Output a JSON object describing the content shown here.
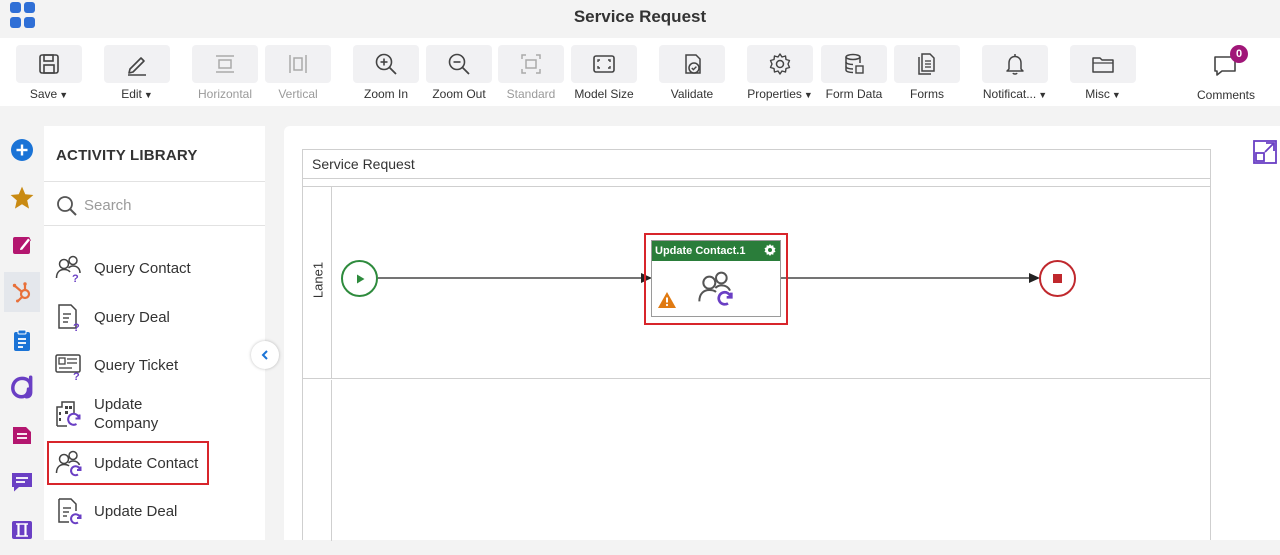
{
  "app": {
    "title": "Service Request"
  },
  "toolbar": {
    "save": "Save",
    "edit": "Edit",
    "horizontal": "Horizontal",
    "vertical": "Vertical",
    "zoom_in": "Zoom In",
    "zoom_out": "Zoom Out",
    "standard": "Standard",
    "model_size": "Model Size",
    "validate": "Validate",
    "properties": "Properties",
    "form_data": "Form Data",
    "forms": "Forms",
    "notifications": "Notificat...",
    "misc": "Misc",
    "comments": "Comments",
    "comments_count": "0"
  },
  "rail": {
    "icons": [
      "add-icon",
      "favorites-star-icon",
      "edit-form-icon",
      "hubspot-icon",
      "clipboard-icon",
      "workflow-icon",
      "document-icon",
      "chat-icon",
      "split-icon"
    ],
    "colors": {
      "blue": "#1a73d6",
      "gold": "#c98a12",
      "magenta": "#b3166f",
      "orange": "#e8703a",
      "purple": "#6a3fc4"
    }
  },
  "library": {
    "title": "ACTIVITY LIBRARY",
    "search_placeholder": "Search",
    "items": [
      {
        "label": "Query Contact",
        "icon": "query-contact-icon"
      },
      {
        "label": "Query Deal",
        "icon": "query-deal-icon"
      },
      {
        "label": "Query Ticket",
        "icon": "query-ticket-icon"
      },
      {
        "label": "Update\nCompany",
        "line1": "Update",
        "line2": "Company",
        "icon": "update-company-icon"
      },
      {
        "label": "Update Contact",
        "icon": "update-contact-icon"
      },
      {
        "label": "Update Deal",
        "icon": "update-deal-icon"
      }
    ]
  },
  "canvas": {
    "pool_title": "Service Request",
    "lane1_label": "Lane1",
    "activity": {
      "title": "Update Contact.1",
      "header_color": "#2a7d3a"
    },
    "colors": {
      "start": "#2e8b3d",
      "end": "#c0282d",
      "selection": "#d8252b",
      "warning": "#e07a12"
    }
  }
}
